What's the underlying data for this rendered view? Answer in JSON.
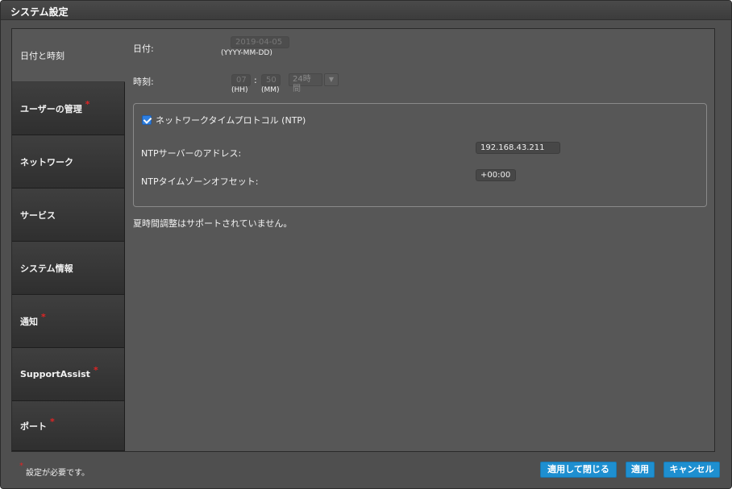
{
  "window": {
    "title": "システム設定"
  },
  "sidebar": {
    "items": [
      {
        "label": "日付と時刻",
        "required": false
      },
      {
        "label": "ユーザーの管理",
        "required": true
      },
      {
        "label": "ネットワーク",
        "required": false
      },
      {
        "label": "サービス",
        "required": false
      },
      {
        "label": "システム情報",
        "required": false
      },
      {
        "label": "通知",
        "required": true
      },
      {
        "label": "SupportAssist",
        "required": true
      },
      {
        "label": "ポート",
        "required": true
      }
    ],
    "required_mark": "*"
  },
  "datetime": {
    "date_label": "日付:",
    "date_value": "2019-04-05",
    "date_format": "(YYYY-MM-DD)",
    "time_label": "時刻:",
    "hour_value": "07",
    "minute_value": "50",
    "time_separator": ":",
    "hour_hint": "(HH)",
    "minute_hint": "(MM)",
    "clock_format": "24時間"
  },
  "ntp": {
    "checkbox_label": "ネットワークタイムプロトコル (NTP)",
    "checked": true,
    "server_label": "NTPサーバーのアドレス:",
    "server_value": "192.168.43.211",
    "offset_label": "NTPタイムゾーンオフセット:",
    "offset_value": "+00:00"
  },
  "dst_note": "夏時間調整はサポートされていません。",
  "footer": {
    "required_mark": "*",
    "required_note": "設定が必要です。",
    "apply_close_label": "適用して閉じる",
    "apply_label": "適用",
    "cancel_label": "キャンセル"
  },
  "colors": {
    "accent": "#1e8fd0",
    "required": "#e02424",
    "background": "#575757"
  },
  "icons": {
    "checkbox": "checkbox-checked-icon",
    "dropdown": "chevron-down-icon"
  }
}
